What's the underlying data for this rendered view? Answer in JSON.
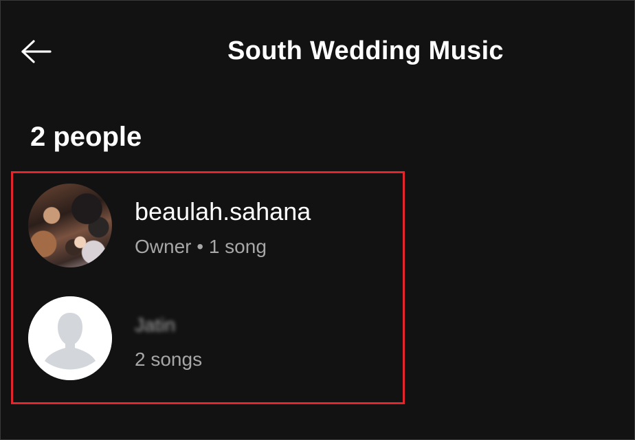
{
  "header": {
    "back_icon": "arrow-left-icon",
    "title": "South Wedding Music"
  },
  "collaborators": {
    "count_label": "2 people",
    "highlight_color": "#e3262b",
    "members": [
      {
        "name": "beaulah.sahana",
        "subtitle": "Owner • 1 song",
        "avatar": "profile-photo"
      },
      {
        "name": "Jatin",
        "subtitle": "2 songs",
        "avatar": "default-user-icon",
        "name_obscured": true
      }
    ]
  },
  "colors": {
    "background": "#121212",
    "primary_text": "#ffffff",
    "secondary_text": "#a7a7a7"
  }
}
